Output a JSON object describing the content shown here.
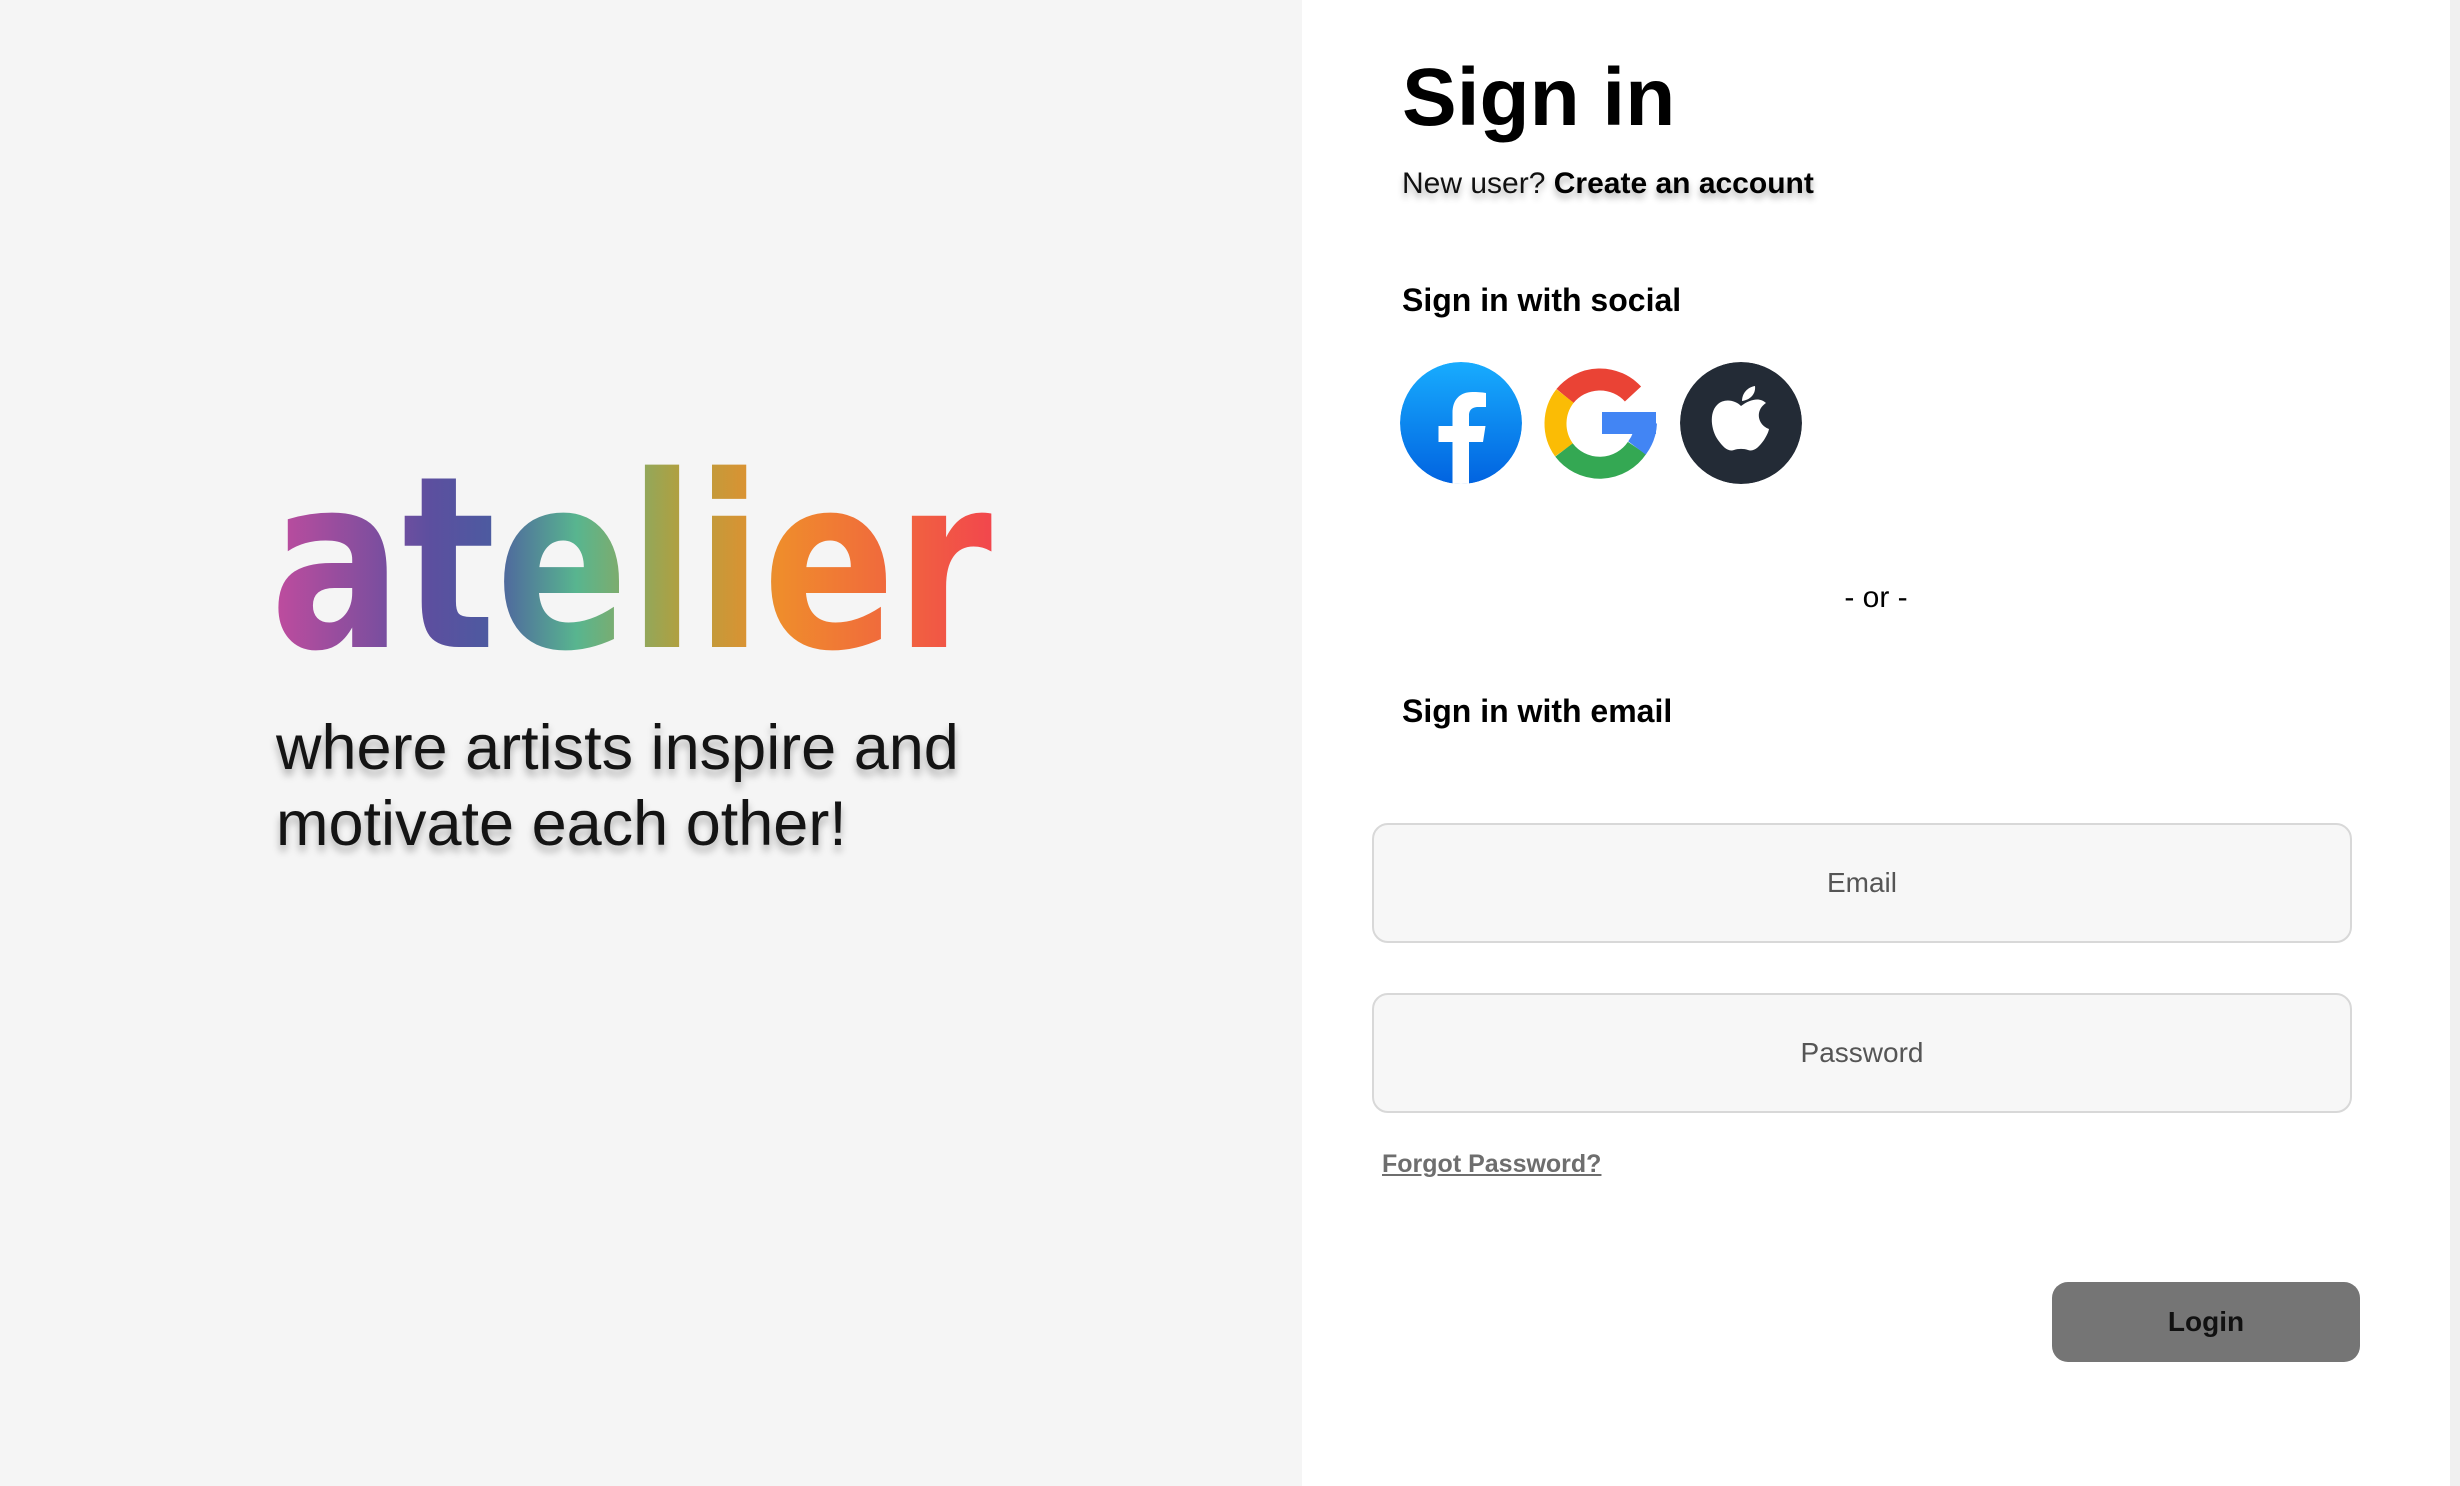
{
  "brand": {
    "logo_text": "atelier",
    "tagline": "where artists inspire and motivate each other!",
    "logo_gradient": [
      "#c04ea0",
      "#5a4fa0",
      "#5ab890",
      "#e8902e",
      "#f04850"
    ]
  },
  "signin": {
    "title": "Sign in",
    "new_user_prompt": "New user?",
    "create_account_label": "Create an account",
    "social_heading": "Sign in with social",
    "social_buttons": [
      {
        "icon": "facebook-icon",
        "color": "#1877f2"
      },
      {
        "icon": "google-icon",
        "colors": [
          "#ea4335",
          "#fbbc05",
          "#34a853",
          "#4285f4"
        ]
      },
      {
        "icon": "apple-icon",
        "color": "#232b36"
      }
    ],
    "or_divider": "- or -",
    "email_heading": "Sign in with email",
    "email_placeholder": "Email",
    "password_placeholder": "Password",
    "forgot_password_label": "Forgot Password?",
    "login_label": "Login"
  },
  "colors": {
    "left_panel_bg": "#f5f5f5",
    "right_panel_bg": "#ffffff",
    "login_button_bg": "#757575",
    "input_bg": "#f7f7f7"
  }
}
